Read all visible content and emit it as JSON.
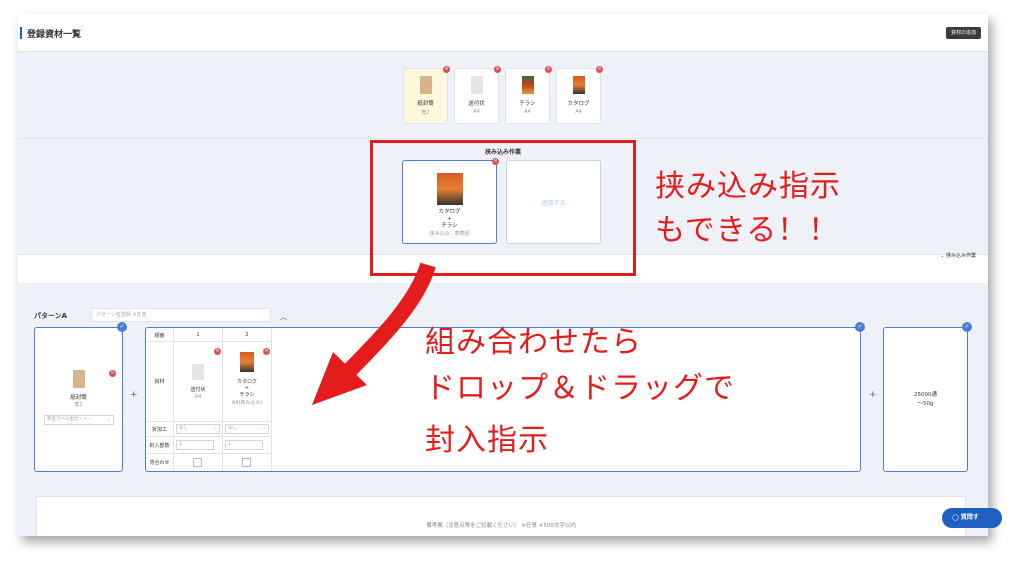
{
  "header": {
    "title": "登録資材一覧",
    "button": "資材の追加"
  },
  "materials": [
    {
      "name": "紙封筒",
      "size": "角2",
      "thumb": "envelope-icon"
    },
    {
      "name": "送付状",
      "size": "A4",
      "thumb": "document-icon"
    },
    {
      "name": "チラシ",
      "size": "A4",
      "thumb": "flyer-icon"
    },
    {
      "name": "カタログ",
      "size": "A4",
      "thumb": "catalog-icon"
    }
  ],
  "insertion": {
    "title": "挟み込み作業",
    "card": {
      "line1": "カタログ",
      "plus": "+",
      "line2": "チラシ",
      "sub": "挟み込み：表表紙"
    },
    "add_label": "追加する",
    "toggle_label": "挟み込み作業"
  },
  "pattern": {
    "label": "パターンA",
    "name_placeholder": "パターン名登録 ※任意",
    "left_card": {
      "name": "紙封筒",
      "size": "角2",
      "select": "宛名ラベル出力・・・"
    },
    "table": {
      "row_labels": [
        "順番",
        "資材",
        "折加工",
        "封入部数",
        "背合わせ"
      ],
      "columns": [
        {
          "order": "1",
          "name": "送付状",
          "size": "A4",
          "fold": "なし",
          "count": "1"
        },
        {
          "order": "2",
          "name_lines": [
            "カタログ",
            "+",
            "チラシ"
          ],
          "size": "A4(挟み込み)",
          "fold": "なし",
          "count": "1"
        }
      ]
    },
    "right_card": {
      "line1": "25000通",
      "line2": "〜50g"
    },
    "plus": "+"
  },
  "remarks_placeholder": "備考欄（注意点等をご記載ください） ※任意 ※500文字以内",
  "help_button": "質問す",
  "annotations": {
    "top": [
      "挟み込み指示",
      "もできる！！"
    ],
    "bottom": [
      "組み合わせたら",
      "ドロップ＆ドラッグで",
      "封入指示"
    ]
  },
  "colors": {
    "accent": "#1f5fbf",
    "annotation": "#e51c1c"
  }
}
